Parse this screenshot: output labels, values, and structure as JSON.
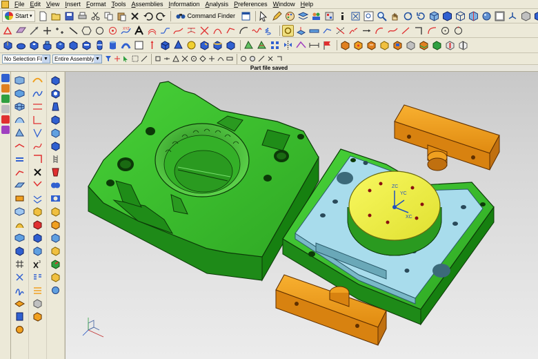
{
  "menu": {
    "items": [
      "File",
      "Edit",
      "View",
      "Insert",
      "Format",
      "Tools",
      "Assemblies",
      "Information",
      "Analysis",
      "Preferences",
      "Window",
      "Help"
    ]
  },
  "toolbar": {
    "start_label": "Start",
    "command_finder_label": "Command Finder"
  },
  "filterbar": {
    "selection_filter": "No Selection Filter",
    "scope": "Entire Assembly"
  },
  "status": {
    "message": "Part file saved"
  },
  "viewport": {
    "csys_labels": [
      "ZC",
      "YC",
      "XC"
    ],
    "colors": {
      "cavity": "#3cc02c",
      "core_plate": "#a8dcec",
      "core_insert": "#f0f040",
      "slider": "#f0a020"
    }
  }
}
